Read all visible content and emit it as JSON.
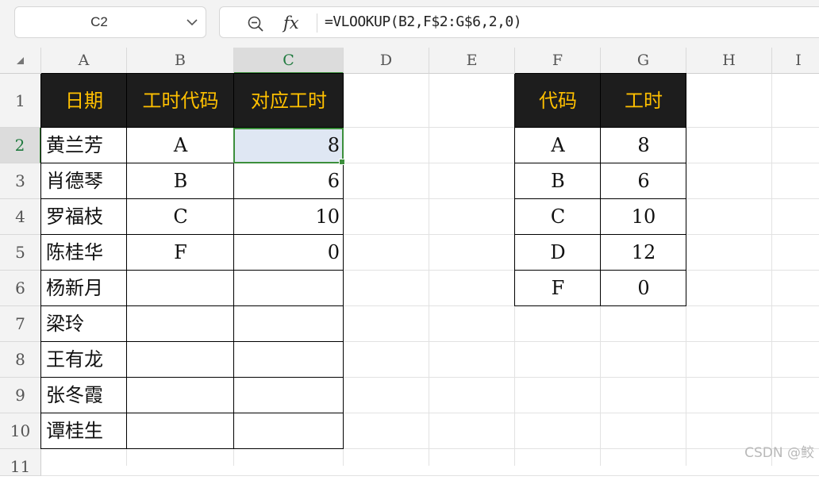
{
  "namebox": {
    "value": "C2"
  },
  "formula_bar": {
    "fx": "fx",
    "formula": "=VLOOKUP(B2,F$2:G$6,2,0)"
  },
  "columns": [
    "A",
    "B",
    "C",
    "D",
    "E",
    "F",
    "G",
    "H",
    "I"
  ],
  "rows": [
    "1",
    "2",
    "3",
    "4",
    "5",
    "6",
    "7",
    "8",
    "9",
    "10",
    "11"
  ],
  "table1": {
    "headers": [
      "日期",
      "工时代码",
      "对应工时"
    ],
    "names": [
      "黄兰芳",
      "肖德琴",
      "罗福枝",
      "陈桂华",
      "杨新月",
      "梁玲",
      "王有龙",
      "张冬霞",
      "谭桂生"
    ],
    "codes": [
      "A",
      "B",
      "C",
      "F",
      "",
      "",
      "",
      "",
      ""
    ],
    "hours": [
      "8",
      "6",
      "10",
      "0",
      "",
      "",
      "",
      "",
      ""
    ]
  },
  "table2": {
    "headers": [
      "代码",
      "工时"
    ],
    "codes": [
      "A",
      "B",
      "C",
      "D",
      "F"
    ],
    "hours": [
      "8",
      "6",
      "10",
      "12",
      "0"
    ]
  },
  "watermark": "CSDN @鲛"
}
